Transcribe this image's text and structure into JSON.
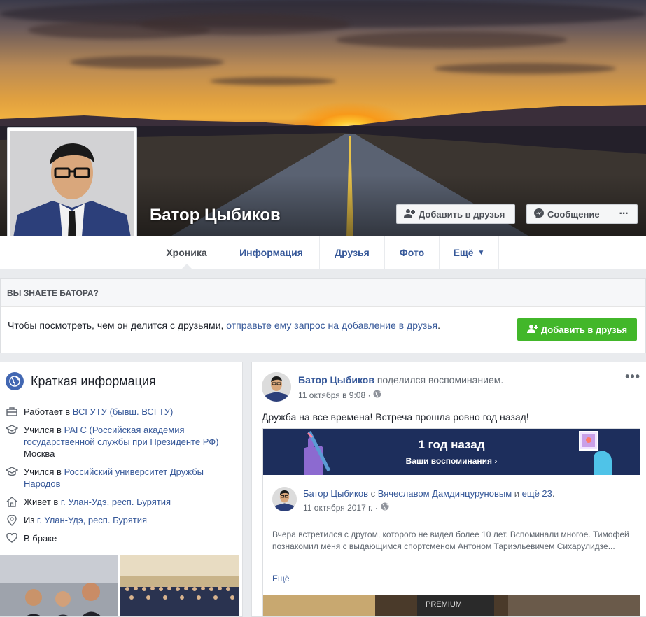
{
  "profile": {
    "name": "Батор Цыбиков",
    "add_friend": "Добавить в друзья",
    "message": "Сообщение",
    "more": "···"
  },
  "tabs": [
    "Хроника",
    "Информация",
    "Друзья",
    "Фото",
    "Ещё"
  ],
  "know": {
    "title": "ВЫ ЗНАЕТЕ БАТОРА?",
    "text": "Чтобы посмотреть, чем он делится с друзьями, ",
    "link": "отправьте ему запрос на добавление в друзья",
    "after": ".",
    "button": "Добавить в друзья"
  },
  "intro": {
    "title": "Краткая информация",
    "items": [
      {
        "prefix": "Работает в ",
        "link": "ВСГУТУ (бывш. ВСГТУ)",
        "icon": "briefcase-icon"
      },
      {
        "prefix": "Учился в ",
        "link": "РАГС (Российская академия государственной службы при Президенте РФ)",
        "suffix": "Москва",
        "icon": "graduation-cap-icon"
      },
      {
        "prefix": "Учился в ",
        "link": "Российский университет Дружбы Народов",
        "icon": "graduation-cap-icon"
      },
      {
        "prefix": "Живет в ",
        "link": "г. Улан-Удэ, респ. Бурятия",
        "icon": "home-icon"
      },
      {
        "prefix": "Из ",
        "link": "г. Улан-Удэ, респ. Бурятия",
        "icon": "map-pin-icon"
      },
      {
        "prefix": "В браке",
        "icon": "heart-icon"
      }
    ]
  },
  "post": {
    "author": "Батор Цыбиков",
    "action": " поделился воспоминанием.",
    "time": "11 октября в 9:08 ·",
    "text": "Дружба на все времена! Встреча прошла ровно год назад!",
    "memory_title": "1 год назад",
    "memory_link": "Ваши воспоминания ›",
    "shared": {
      "author": "Батор Цыбиков",
      "with": " с ",
      "with_name": "Вячеславом Дамдинцуруновым",
      "and": " и ",
      "others": "ещё 23",
      "dot": ".",
      "time": "11 октября 2017 г. ·",
      "text": "Вчера встретился с другом, которого не видел более 10 лет. Вспоминали многое. Тимофей познакомил меня с выдающимся спортсменом Антоном Тариэльевичем Сихарулидзе...",
      "more": "Ещё"
    }
  }
}
